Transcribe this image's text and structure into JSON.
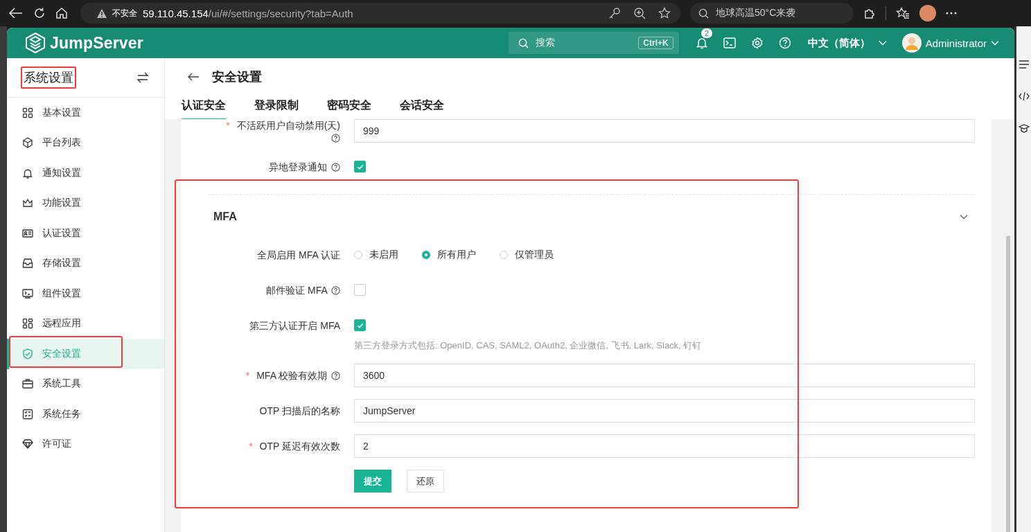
{
  "browser": {
    "security_label": "不安全",
    "host": "59.110.45.154",
    "path": "/ui/#/settings/security?tab=Auth",
    "search": "地球高温50°C来袭"
  },
  "header": {
    "brand": "JumpServer",
    "search_placeholder": "搜索",
    "shortcut": "Ctrl+K",
    "notifications": "2",
    "language": "中文（简体）",
    "user": "Administrator"
  },
  "sidebar": {
    "title": "系统设置",
    "title_highlighted": true,
    "items": [
      {
        "label": "基本设置",
        "selected": false,
        "highlighted": false
      },
      {
        "label": "平台列表",
        "selected": false,
        "highlighted": false
      },
      {
        "label": "通知设置",
        "selected": false,
        "highlighted": false
      },
      {
        "label": "功能设置",
        "selected": false,
        "highlighted": false
      },
      {
        "label": "认证设置",
        "selected": false,
        "highlighted": false
      },
      {
        "label": "存储设置",
        "selected": false,
        "highlighted": false
      },
      {
        "label": "组件设置",
        "selected": false,
        "highlighted": false
      },
      {
        "label": "远程应用",
        "selected": false,
        "highlighted": false
      },
      {
        "label": "安全设置",
        "selected": true,
        "highlighted": true
      },
      {
        "label": "系统工具",
        "selected": false,
        "highlighted": false
      },
      {
        "label": "系统任务",
        "selected": false,
        "highlighted": false
      },
      {
        "label": "许可证",
        "selected": false,
        "highlighted": false
      }
    ]
  },
  "page": {
    "title": "安全设置",
    "tabs": [
      {
        "label": "认证安全",
        "selected": true
      },
      {
        "label": "登录限制",
        "selected": false
      },
      {
        "label": "密码安全",
        "selected": false
      },
      {
        "label": "会话安全",
        "selected": false
      }
    ]
  },
  "fields": [
    {
      "kind": "input",
      "label": "不活跃用户自动禁用(天)",
      "required_mark": "*",
      "help": true,
      "value": "999"
    },
    {
      "kind": "checkbox",
      "label": "异地登录通知",
      "help": true,
      "checked": true
    }
  ],
  "mfa": {
    "title": "MFA",
    "expanded": true,
    "highlighted": true,
    "fields": [
      {
        "kind": "radio",
        "label": "全局启用 MFA 认证",
        "help": false,
        "options": [
          {
            "label": "未启用",
            "selected": false
          },
          {
            "label": "所有用户",
            "selected": true
          },
          {
            "label": "仅管理员",
            "selected": false
          }
        ]
      },
      {
        "kind": "checkbox",
        "label": "邮件验证 MFA",
        "help": true,
        "checked": false
      },
      {
        "kind": "checkbox",
        "label": "第三方认证开启 MFA",
        "help": false,
        "checked": true,
        "hint": "第三方登录方式包括: OpenID, CAS, SAML2, OAuth2, 企业微信, 飞书, Lark, Slack, 钉钉"
      },
      {
        "kind": "input",
        "label": "MFA 校验有效期",
        "required_mark": "*",
        "help": true,
        "value": "3600"
      },
      {
        "kind": "input",
        "label": "OTP 扫描后的名称",
        "help": false,
        "value": "JumpServer"
      },
      {
        "kind": "input",
        "label": "OTP 延迟有效次数",
        "required_mark": "*",
        "help": false,
        "value": "2"
      }
    ],
    "buttons": [
      {
        "kind": "primary",
        "label": "提交"
      },
      {
        "kind": "default",
        "label": "还原"
      }
    ]
  }
}
